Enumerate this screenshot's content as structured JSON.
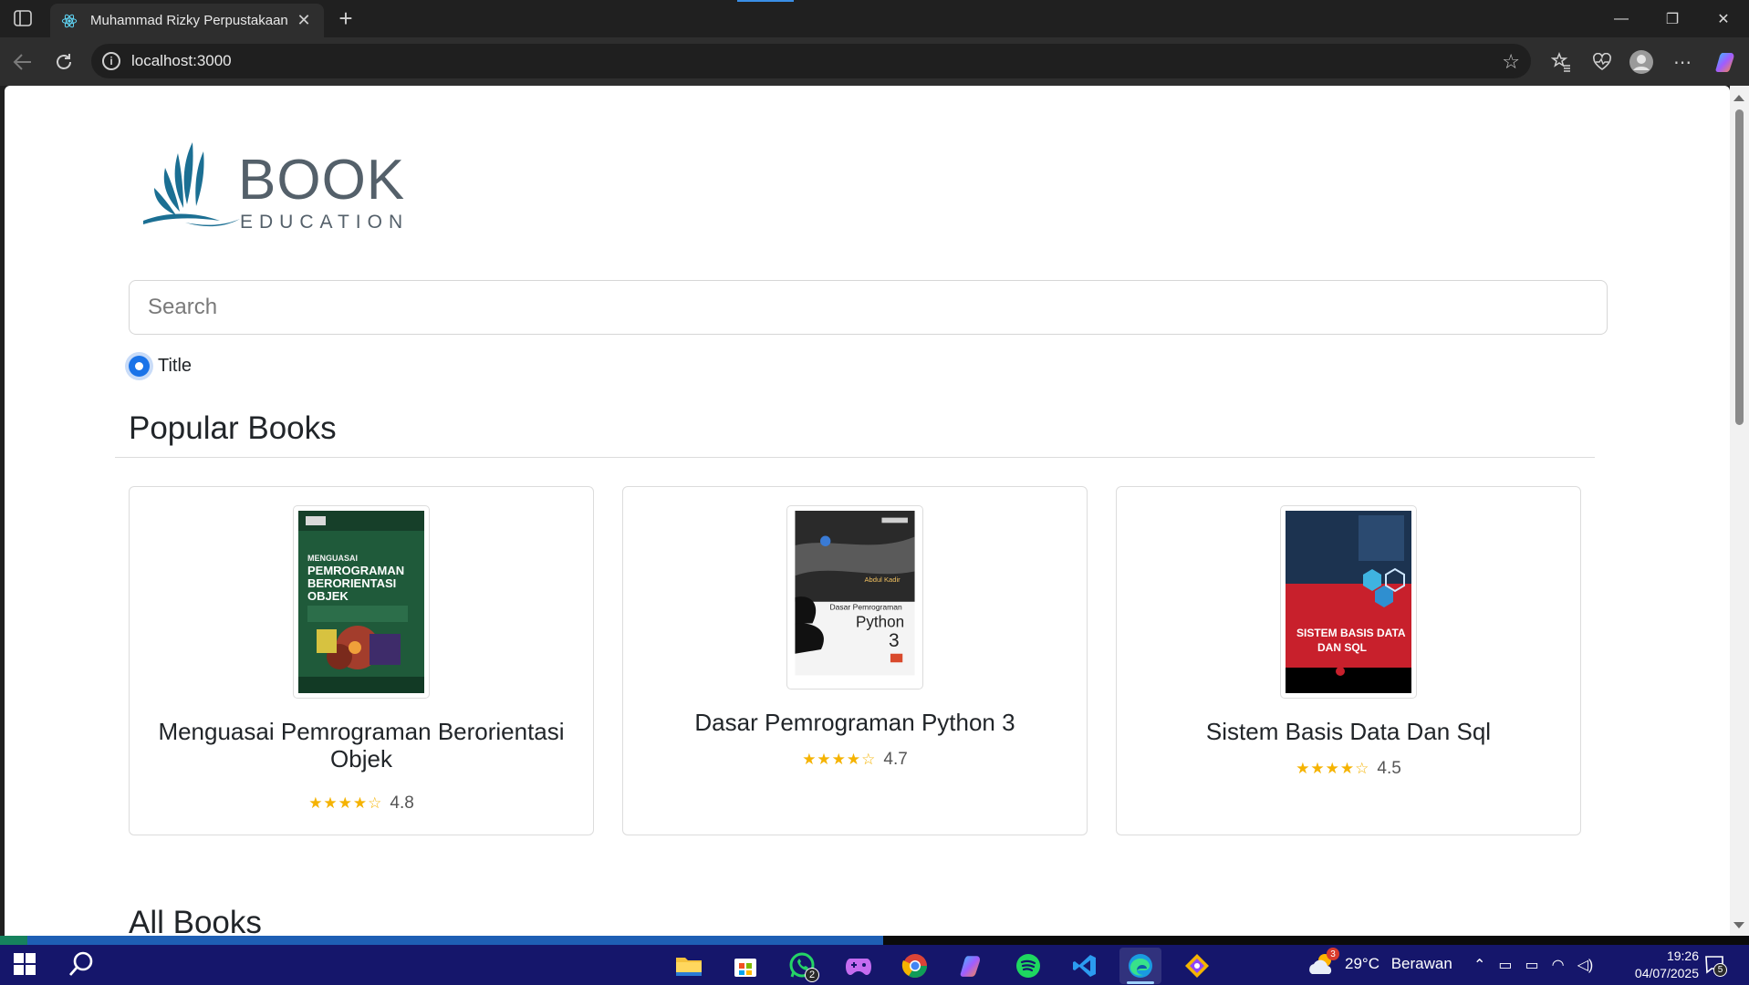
{
  "browser": {
    "tab_title": "Muhammad Rizky Perpustakaan",
    "tab_close": "✕",
    "new_tab": "+",
    "url": "localhost:3000",
    "window_controls": {
      "minimize": "—",
      "restore": "❐",
      "close": "✕"
    }
  },
  "logo": {
    "line1": "BOOK",
    "line2": "EDUCATION"
  },
  "search": {
    "placeholder": "Search"
  },
  "filter": {
    "option_label": "Title",
    "selected": true
  },
  "popular": {
    "heading": "Popular Books",
    "books": [
      {
        "title": "Menguasai Pemrograman Berorientasi Objek",
        "rating": "4.8",
        "stars": "★★★★☆",
        "cover_color": "#1f5a3a"
      },
      {
        "title": "Dasar Pemrograman Python 3",
        "rating": "4.7",
        "stars": "★★★★☆",
        "cover_color": "#f4f4f4"
      },
      {
        "title": "Sistem Basis Data Dan Sql",
        "rating": "4.5",
        "stars": "★★★★☆",
        "cover_color": "#c8202c"
      }
    ]
  },
  "all_books": {
    "heading": "All Books"
  },
  "taskbar": {
    "weather_temp": "29°C",
    "weather_desc": "Berawan",
    "weather_badge": "3",
    "whatsapp_badge": "2",
    "time": "19:26",
    "date": "04/07/2025",
    "notifications": "5",
    "apps": [
      "start-icon",
      "search-icon",
      "file-explorer-icon",
      "store-icon",
      "whatsapp-icon",
      "game-icon",
      "chrome-icon",
      "copilot-icon",
      "spotify-icon",
      "vscode-icon",
      "edge-icon",
      "git-icon"
    ]
  }
}
